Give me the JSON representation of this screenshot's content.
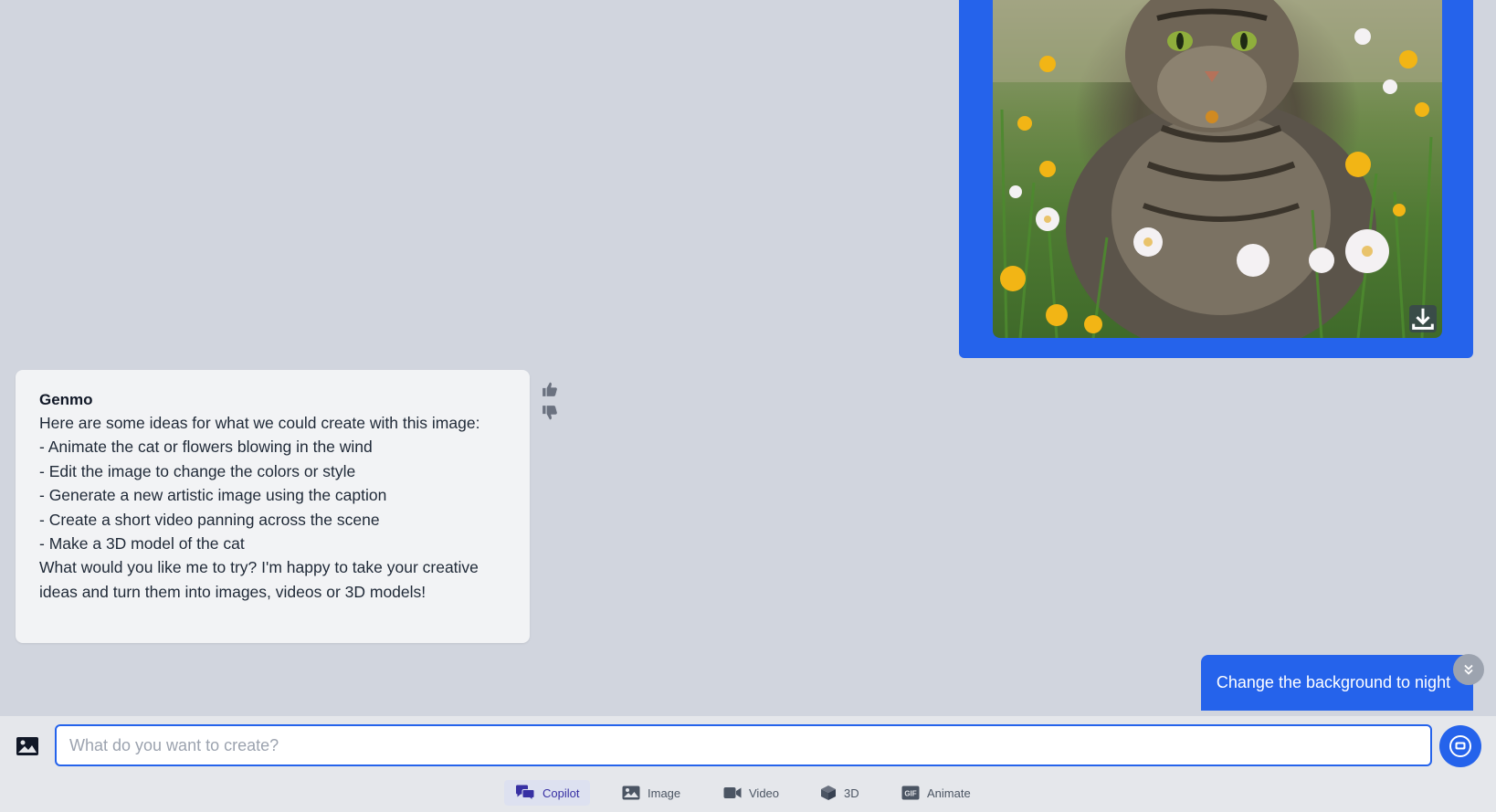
{
  "image_message": {
    "download_icon": "download-icon"
  },
  "assistant_message": {
    "name": "Genmo",
    "text": "Here are some ideas for what we could create with this image:\n- Animate the cat or flowers blowing in the wind\n- Edit the image to change the colors or style\n- Generate a new artistic image using the caption\n- Create a short video panning across the scene\n- Make a 3D model of the cat\nWhat would you like me to try? I'm happy to take your creative ideas and turn them into images, videos or 3D models!"
  },
  "user_message": {
    "text": "Change the background to night"
  },
  "composer": {
    "placeholder": "What do you want to create?",
    "value": ""
  },
  "modes": [
    {
      "label": "Copilot",
      "icon": "chat-bubbles-icon",
      "active": true
    },
    {
      "label": "Image",
      "icon": "image-icon",
      "active": false
    },
    {
      "label": "Video",
      "icon": "video-camera-icon",
      "active": false
    },
    {
      "label": "3D",
      "icon": "cube-icon",
      "active": false
    },
    {
      "label": "Animate",
      "icon": "gif-icon",
      "active": false
    }
  ],
  "colors": {
    "accent": "#2563eb",
    "background": "#d1d5de",
    "bubble": "#f2f3f5",
    "active_mode": "#3730a3"
  }
}
